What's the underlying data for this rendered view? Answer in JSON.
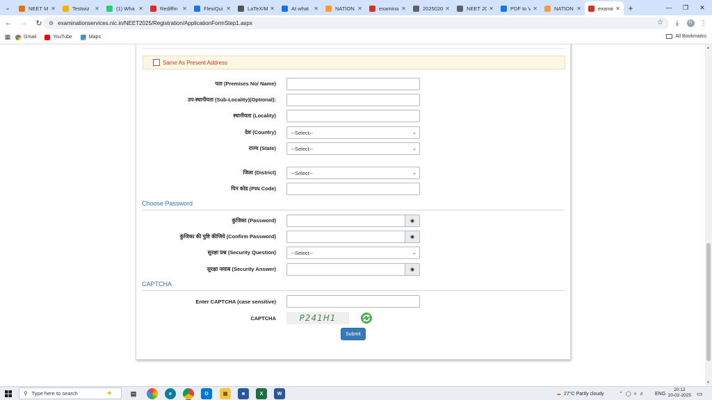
{
  "browser": {
    "tabs": [
      {
        "label": "NEET M",
        "color": "#e8710a"
      },
      {
        "label": "Testwiz",
        "color": "#f4b400"
      },
      {
        "label": "(1) Wha",
        "color": "#25d366"
      },
      {
        "label": "Rediffm",
        "color": "#d93025"
      },
      {
        "label": "FlexiQui",
        "color": "#1a73e8"
      },
      {
        "label": "LaTeX/M",
        "color": "#555555"
      },
      {
        "label": "At what",
        "color": "#1a73e8"
      },
      {
        "label": "NATION",
        "color": "#ff9933"
      },
      {
        "label": "examina",
        "color": "#d93025"
      },
      {
        "label": "2025020",
        "color": "#5f6368"
      },
      {
        "label": "NEET 20",
        "color": "#5f6368"
      },
      {
        "label": "PDF to V",
        "color": "#1a73e8"
      },
      {
        "label": "NATION",
        "color": "#ff9933"
      }
    ],
    "active_tab": {
      "label": "examina",
      "color": "#d93025"
    },
    "url": "examinationservices.nic.in/NEET2025/Registration/ApplicationFormStep1.aspx",
    "profile_initial": "N",
    "bookmarks": [
      {
        "label": "Gmail",
        "icon": "google-icon"
      },
      {
        "label": "YouTube",
        "icon": "youtube-icon"
      },
      {
        "label": "Maps",
        "icon": "maps-icon"
      }
    ],
    "all_bookmarks": "All Bookmarks"
  },
  "form": {
    "same_as_present": "Same As Present Address",
    "address_fields": [
      {
        "label": "पता (Premises No/ Name)",
        "type": "text"
      },
      {
        "label": "उप-स्थानीयता (Sub-Locality)(Optional):",
        "type": "text"
      },
      {
        "label": "स्थानीयता (Locality)",
        "type": "text"
      },
      {
        "label": "देश (Country)",
        "type": "select",
        "value": "--Select--"
      },
      {
        "label": "राज्य (State)",
        "type": "select",
        "value": "--Select--"
      },
      {
        "label": "जिला (District)",
        "type": "select",
        "value": "--Select--"
      },
      {
        "label": "पिन कोड (PIN Code)",
        "type": "text"
      }
    ],
    "password_section": "Choose Password",
    "password_fields": [
      {
        "label": "कुंजिका (Password)",
        "type": "password"
      },
      {
        "label": "कुंजिका की पुष्टि कीजिये (Confirm Password)",
        "type": "password"
      },
      {
        "label": "सुरक्षा प्रश्न (Security Question)",
        "type": "select",
        "value": "--Select--"
      },
      {
        "label": "सुरक्षा जवाब (Security Answer)",
        "type": "password"
      }
    ],
    "captcha_section": "CAPTCHA",
    "captcha_input_label": "Enter CAPTCHA (case sensitive)",
    "captcha_label": "CAPTCHA",
    "captcha_text": "P241H1",
    "submit": "Submit"
  },
  "taskbar": {
    "search_placeholder": "Type here to search",
    "weather": "27°C  Partly cloudy",
    "lang": "ENG",
    "time": "20:12",
    "date": "20-02-2025"
  }
}
